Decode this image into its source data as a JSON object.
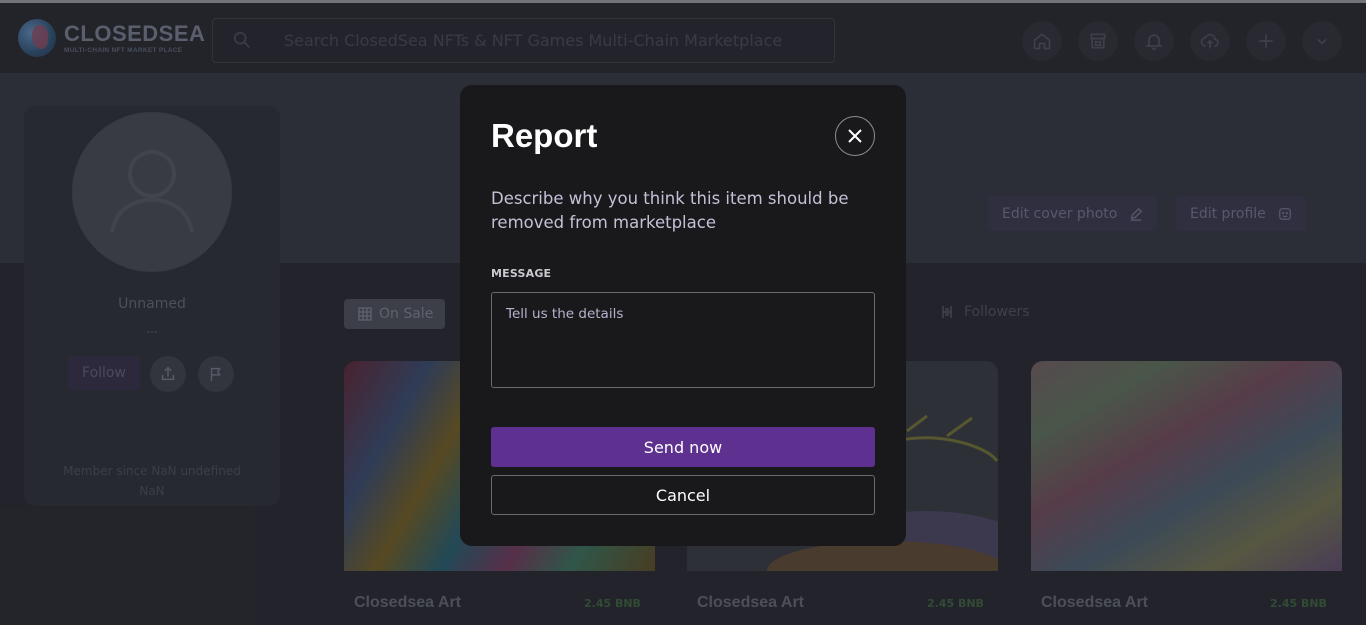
{
  "header": {
    "logo_title": "CLOSEDSEA",
    "logo_subtitle": "MULTI-CHAIN NFT MARKET PLACE",
    "search_placeholder": "Search ClosedSea NFTs & NFT Games Multi-Chain Marketplace",
    "nav_icons": [
      "home-icon",
      "store-icon",
      "bell-icon",
      "upload-cloud-icon",
      "plus-icon",
      "chevron-down-icon"
    ]
  },
  "cover": {
    "edit_cover_label": "Edit cover photo",
    "edit_profile_label": "Edit profile"
  },
  "profile": {
    "name": "Unnamed",
    "handle": "...",
    "follow_label": "Follow",
    "member_since": "Member since NaN undefined",
    "member_since_line2": "NaN"
  },
  "tabs": {
    "on_sale": "On Sale",
    "followers": "Followers"
  },
  "nfts": [
    {
      "title": "Closedsea Art",
      "price": "2.45 BNB"
    },
    {
      "title": "Closedsea Art",
      "price": "2.45 BNB"
    },
    {
      "title": "Closedsea Art",
      "price": "2.45 BNB"
    }
  ],
  "modal": {
    "title": "Report",
    "description": "Describe why you think this item should be removed from marketplace",
    "message_label": "MESSAGE",
    "message_placeholder": "Tell us the details",
    "message_value": "",
    "send_label": "Send now",
    "cancel_label": "Cancel"
  },
  "colors": {
    "accent": "#5e3190",
    "modal_bg": "#19191c",
    "page_bg": "#2b2d35"
  }
}
